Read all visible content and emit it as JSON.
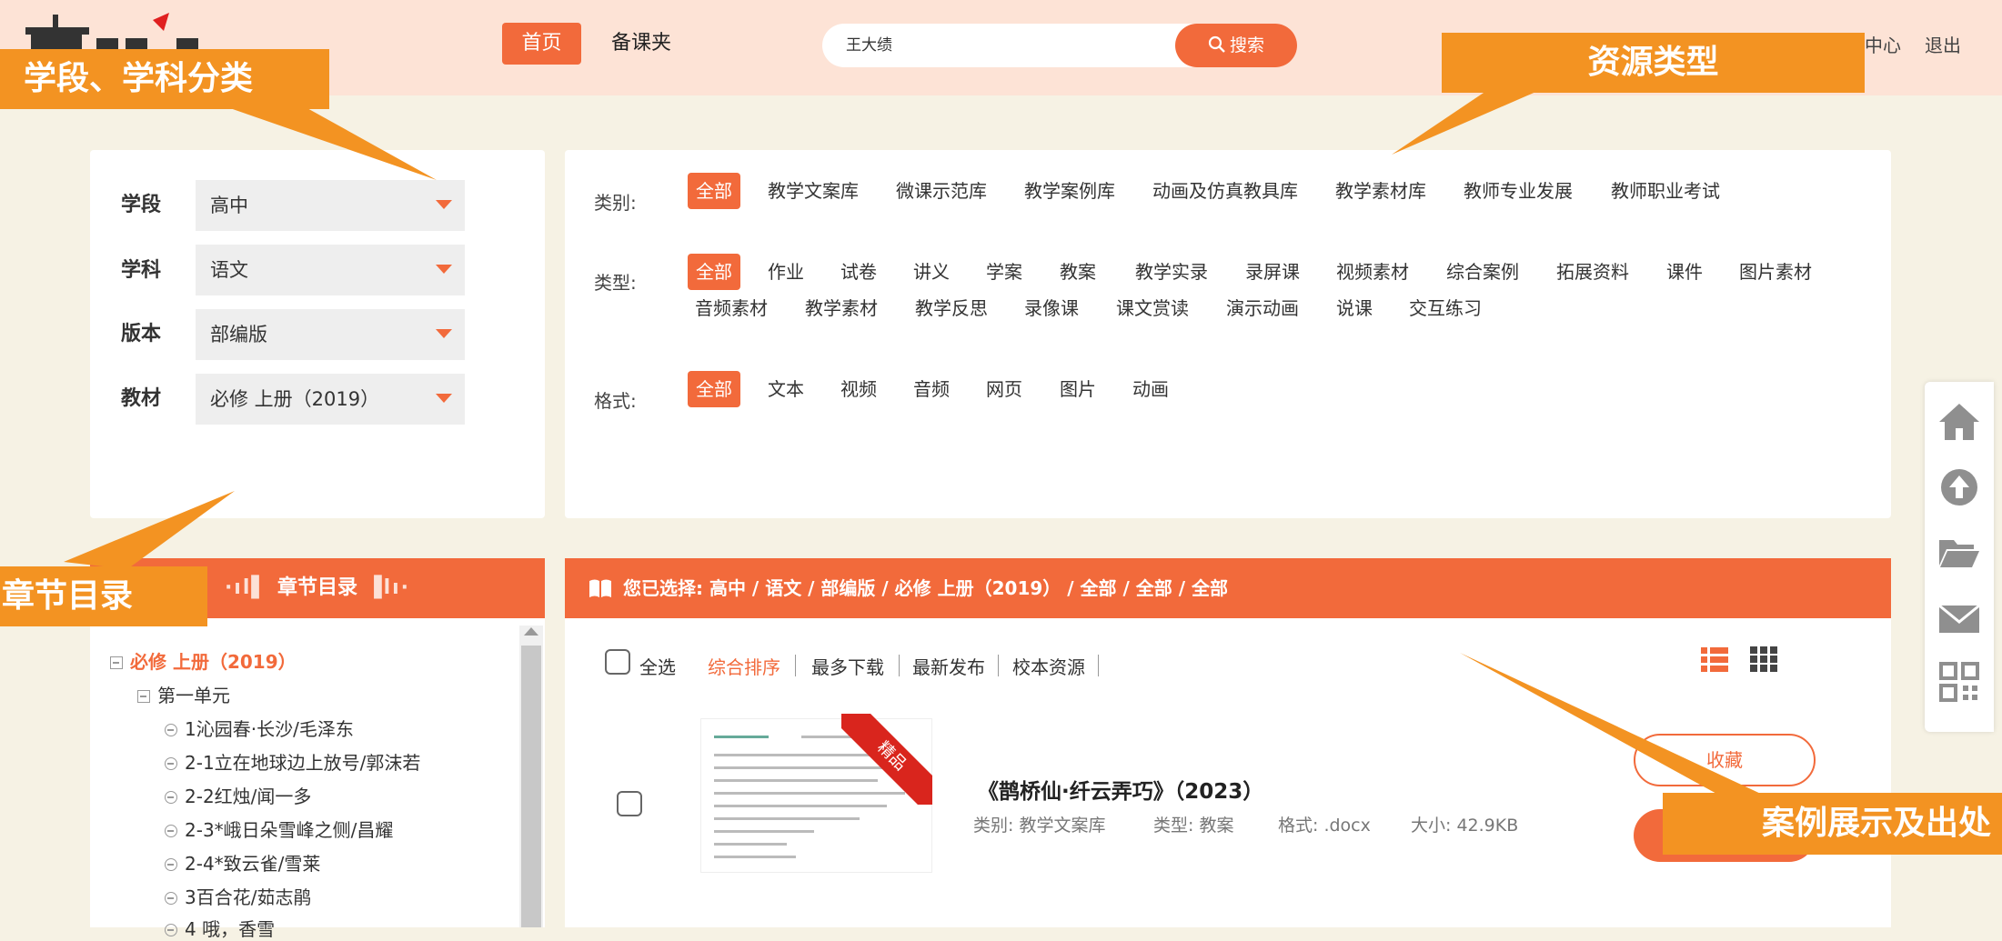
{
  "header": {
    "nav_home": "首页",
    "nav_prep": "备课夹",
    "search_value": "王大绩",
    "search_button": "搜索",
    "user_center": "中心",
    "logout": "退出"
  },
  "filters": [
    {
      "label": "学段",
      "value": "高中"
    },
    {
      "label": "学科",
      "value": "语文"
    },
    {
      "label": "版本",
      "value": "部编版"
    },
    {
      "label": "教材",
      "value": "必修 上册（2019）"
    }
  ],
  "type_rows": {
    "category": {
      "label": "类别:",
      "items": [
        "全部",
        "教学文案库",
        "微课示范库",
        "教学案例库",
        "动画及仿真教具库",
        "教学素材库",
        "教师专业发展",
        "教师职业考试"
      ]
    },
    "type": {
      "label": "类型:",
      "items": [
        "全部",
        "作业",
        "试卷",
        "讲义",
        "学案",
        "教案",
        "教学实录",
        "录屏课",
        "视频素材",
        "综合案例",
        "拓展资料",
        "课件",
        "图片素材",
        "音频素材",
        "教学素材",
        "教学反思",
        "录像课",
        "课文赏读",
        "演示动画",
        "说课",
        "交互练习"
      ]
    },
    "format": {
      "label": "格式:",
      "items": [
        "全部",
        "文本",
        "视频",
        "音频",
        "网页",
        "图片",
        "动画"
      ]
    }
  },
  "chapter": {
    "header": "章节目录",
    "root": "必修 上册（2019）",
    "unit": "第一单元",
    "items": [
      "1沁园春·长沙/毛泽东",
      "2-1立在地球边上放号/郭沫若",
      "2-2红烛/闻一多",
      "2-3*峨日朵雪峰之侧/昌耀",
      "2-4*致云雀/雪莱",
      "3百合花/茹志鹃",
      "4 哦，香雪"
    ]
  },
  "results": {
    "selected_prefix": "您已选择:",
    "selected_path": "高中 / 语文 / 部编版 / 必修 上册（2019） / 全部 / 全部 / 全部",
    "select_all": "全选",
    "sort_options": [
      "综合排序",
      "最多下载",
      "最新发布",
      "校本资源"
    ],
    "item": {
      "badge": "精品",
      "title": "《鹊桥仙·纤云弄巧》（2023）",
      "category": "类别: 教学文案库",
      "type": "类型: 教案",
      "format": "格式: .docx",
      "size": "大小: 42.9KB",
      "favorite": "收藏"
    }
  },
  "callouts": {
    "stage_subject": "学段、学科分类",
    "resource_type": "资源类型",
    "chapter_dir": "章节目录",
    "case_display": "案例展示及出处"
  },
  "colors": {
    "accent": "#f26a3b",
    "callout": "#f39322",
    "header_bg": "#fde3d6"
  },
  "icons": [
    "home-icon",
    "upload-icon",
    "folder-icon",
    "mail-icon",
    "qrcode-icon",
    "list-view-icon",
    "grid-view-icon",
    "book-icon"
  ]
}
